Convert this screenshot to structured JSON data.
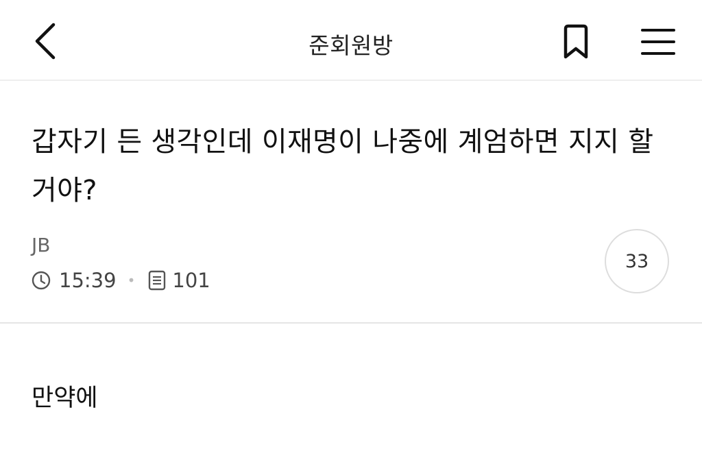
{
  "header": {
    "title": "준회원방",
    "back_icon": "chevron-left-icon",
    "bookmark_icon": "bookmark-icon",
    "menu_icon": "hamburger-menu-icon"
  },
  "post": {
    "title": "갑자기 든 생각인데 이재명이 나중에 계엄하면 지지 할거야?",
    "author": "JB",
    "time": "15:39",
    "views": "101",
    "comment_count": "33",
    "body": "만약에"
  }
}
